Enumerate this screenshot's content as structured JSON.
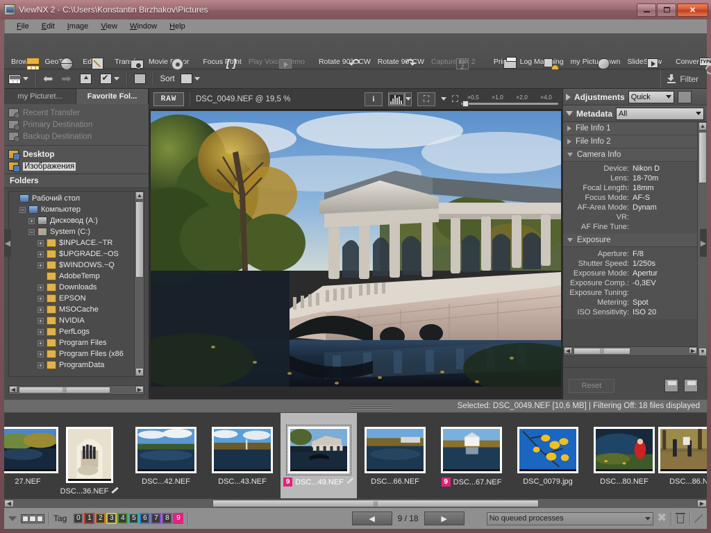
{
  "window": {
    "title": "ViewNX 2 - C:\\Users\\Konstantin Birzhakov\\Pictures",
    "app_icon": "viewnx-icon",
    "minimize_label": "–",
    "maximize_label": "❐",
    "close_label": "✕"
  },
  "menu": [
    {
      "label": "File"
    },
    {
      "label": "Edit"
    },
    {
      "label": "Image"
    },
    {
      "label": "View"
    },
    {
      "label": "Window"
    },
    {
      "label": "Help"
    }
  ],
  "toolbar": {
    "groups": [
      {
        "items": [
          {
            "label": "Browser",
            "icon": "browser-icon",
            "disabled": false
          },
          {
            "label": "GeoTag",
            "icon": "globe-icon",
            "disabled": false
          },
          {
            "label": "Edit",
            "icon": "pen-icon",
            "disabled": false
          }
        ]
      },
      {
        "items": [
          {
            "label": "Transfer",
            "icon": "camera-icon",
            "disabled": false
          },
          {
            "label": "Movie Editor",
            "icon": "film-reel-icon",
            "disabled": false
          }
        ]
      },
      {
        "items": [
          {
            "label": "Focus Point",
            "icon": "focus-brackets-icon",
            "disabled": false
          },
          {
            "label": "Play Voice Memo",
            "icon": "play-icon",
            "disabled": true
          }
        ]
      },
      {
        "items": [
          {
            "label": "Rotate 90°CCW",
            "icon": "rotate-ccw-icon",
            "disabled": false
          },
          {
            "label": "Rotate 90°CW",
            "icon": "rotate-cw-icon",
            "disabled": false
          },
          {
            "label": "Capture NX 2",
            "icon": "capture-nx-icon",
            "disabled": true
          }
        ]
      },
      {
        "items": [
          {
            "label": "Print",
            "icon": "printer-icon",
            "disabled": false
          },
          {
            "label": "Log Matching",
            "icon": "log-matching-icon",
            "disabled": false
          },
          {
            "label": "my Picturetown",
            "icon": "picturetown-icon",
            "disabled": false
          },
          {
            "label": "SlideShow",
            "icon": "slideshow-icon",
            "disabled": false
          }
        ]
      },
      {
        "items": [
          {
            "label": "Convert Files",
            "icon": "convert-files-icon",
            "disabled": false
          }
        ]
      }
    ]
  },
  "subbar": {
    "view_grid": "thumbnail-grid-icon",
    "back": "back-arrow-icon",
    "forward": "forward-arrow-icon",
    "up": "up-folder-icon",
    "rating": "check-mark-icon",
    "window": "window-icon",
    "sort_label": "Sort",
    "sort_icon": "camera-icon",
    "filter_label": "Filter",
    "filter_icon": "filter-download-icon"
  },
  "left_panel": {
    "tabs": [
      {
        "label": "my Picturet...",
        "active": false
      },
      {
        "label": "Favorite Fol...",
        "active": true
      }
    ],
    "transfer_items": [
      {
        "label": "Recent Transfer",
        "enabled": false
      },
      {
        "label": "Primary Destination",
        "enabled": false
      },
      {
        "label": "Backup Destination",
        "enabled": false
      }
    ],
    "favorites": [
      {
        "label": "Desktop",
        "selected": false
      },
      {
        "label": "Изображения",
        "selected": true
      }
    ],
    "folders_header": "Folders",
    "tree": [
      {
        "label": "Рабочий стол",
        "indent": 0,
        "expander": "",
        "icon": "desktop-icon"
      },
      {
        "label": "Компьютер",
        "indent": 1,
        "expander": "−",
        "icon": "computer-icon"
      },
      {
        "label": "Дисковод (A:)",
        "indent": 2,
        "expander": "+",
        "icon": "drive-icon"
      },
      {
        "label": "System (C:)",
        "indent": 2,
        "expander": "−",
        "icon": "system-drive-icon"
      },
      {
        "label": "$INPLACE.~TR",
        "indent": 3,
        "expander": "+",
        "icon": "folder-icon"
      },
      {
        "label": "$UPGRADE.~OS",
        "indent": 3,
        "expander": "+",
        "icon": "folder-icon"
      },
      {
        "label": "$WINDOWS.~Q",
        "indent": 3,
        "expander": "+",
        "icon": "folder-icon"
      },
      {
        "label": "AdobeTemp",
        "indent": 3,
        "expander": "",
        "icon": "folder-icon"
      },
      {
        "label": "Downloads",
        "indent": 3,
        "expander": "+",
        "icon": "folder-icon"
      },
      {
        "label": "EPSON",
        "indent": 3,
        "expander": "+",
        "icon": "folder-icon"
      },
      {
        "label": "MSOCache",
        "indent": 3,
        "expander": "+",
        "icon": "folder-icon"
      },
      {
        "label": "NVIDIA",
        "indent": 3,
        "expander": "+",
        "icon": "folder-icon"
      },
      {
        "label": "PerfLogs",
        "indent": 3,
        "expander": "+",
        "icon": "folder-icon"
      },
      {
        "label": "Program Files",
        "indent": 3,
        "expander": "+",
        "icon": "folder-icon"
      },
      {
        "label": "Program Files (x86",
        "indent": 3,
        "expander": "+",
        "icon": "folder-icon"
      },
      {
        "label": "ProgramData",
        "indent": 3,
        "expander": "+",
        "icon": "folder-icon"
      }
    ]
  },
  "viewer": {
    "raw_badge": "RAW",
    "file_title": "DSC_0049.NEF @ 19,5 %",
    "info_icon": "info-icon",
    "histogram_icon": "histogram-icon",
    "fit_icon": "fit-to-window-icon",
    "zoom_reset_icon": "zoom-reset-icon",
    "zoom_ticks": [
      "×0,5",
      "×1,0",
      "×2,0",
      "×4,0"
    ],
    "image_alt": "Marble Bridge in autumn park reflected in pond"
  },
  "right_panel": {
    "adjustments": {
      "title": "Adjustments",
      "mode": "Quick",
      "revert_icon": "revert-icon"
    },
    "metadata": {
      "title": "Metadata",
      "filter": "All"
    },
    "sections": [
      {
        "title": "File Info 1",
        "expanded": false,
        "rows": []
      },
      {
        "title": "File Info 2",
        "expanded": false,
        "rows": []
      },
      {
        "title": "Camera Info",
        "expanded": true,
        "rows": [
          {
            "label": "Device:",
            "value": "Nikon D"
          },
          {
            "label": "Lens:",
            "value": "18-70m"
          },
          {
            "label": "Focal Length:",
            "value": "18mm"
          },
          {
            "label": "Focus Mode:",
            "value": "AF-S"
          },
          {
            "label": "AF-Area Mode:",
            "value": "Dynam"
          },
          {
            "label": "VR:",
            "value": ""
          },
          {
            "label": "AF Fine Tune:",
            "value": ""
          }
        ]
      },
      {
        "title": "Exposure",
        "expanded": true,
        "rows": [
          {
            "label": "Aperture:",
            "value": "F/8"
          },
          {
            "label": "Shutter Speed:",
            "value": "1/250s"
          },
          {
            "label": "Exposure Mode:",
            "value": "Apertur"
          },
          {
            "label": "Exposure Comp.:",
            "value": "-0,3EV"
          },
          {
            "label": "Exposure Tuning:",
            "value": ""
          },
          {
            "label": "Metering:",
            "value": "Spot"
          },
          {
            "label": "ISO Sensitivity:",
            "value": "ISO 20"
          }
        ]
      }
    ],
    "reset_label": "Reset",
    "save_icons": [
      "save-as-icon",
      "save-icon"
    ]
  },
  "status": {
    "text": "Selected: DSC_0049.NEF [10,6 MB] | Filtering Off: 18 files displayed"
  },
  "filmstrip": [
    {
      "label": "27.NEF",
      "tag": "",
      "brush": false,
      "selected": false,
      "scene": "pond-autumn"
    },
    {
      "label": "DSC...36.NEF",
      "tag": "",
      "brush": true,
      "selected": false,
      "scene": "arch-people"
    },
    {
      "label": "DSC...42.NEF",
      "tag": "",
      "brush": false,
      "selected": false,
      "scene": "lake-clouds"
    },
    {
      "label": "DSC...43.NEF",
      "tag": "",
      "brush": false,
      "selected": false,
      "scene": "lake-shore"
    },
    {
      "label": "DSC...49.NEF",
      "tag": "9",
      "brush": true,
      "selected": true,
      "scene": "bridge"
    },
    {
      "label": "DSC...66.NEF",
      "tag": "",
      "brush": false,
      "selected": false,
      "scene": "park-lake"
    },
    {
      "label": "DSC...67.NEF",
      "tag": "9",
      "brush": false,
      "selected": false,
      "scene": "white-pavilion"
    },
    {
      "label": "DSC_0079.jpg",
      "tag": "",
      "brush": false,
      "selected": false,
      "scene": "yellow-leaves"
    },
    {
      "label": "DSC...80.NEF",
      "tag": "",
      "brush": false,
      "selected": false,
      "scene": "red-coat"
    },
    {
      "label": "DSC...86.N",
      "tag": "",
      "brush": false,
      "selected": false,
      "scene": "people-park"
    }
  ],
  "bottom_bar": {
    "expand_icon": "chevron-down-icon",
    "viewmode_icon": "filmstrip-view-icon",
    "tag_label": "Tag",
    "tags": [
      {
        "label": "0",
        "color": "#808080",
        "active": false
      },
      {
        "label": "1",
        "color": "#c0392b",
        "active": false
      },
      {
        "label": "2",
        "color": "#c87828",
        "active": false
      },
      {
        "label": "3",
        "color": "#d4c52a",
        "active": false
      },
      {
        "label": "4",
        "color": "#4a9e3a",
        "active": false
      },
      {
        "label": "5",
        "color": "#2ab5a5",
        "active": false
      },
      {
        "label": "6",
        "color": "#3a7bd5",
        "active": false
      },
      {
        "label": "7",
        "color": "#7a4fd0",
        "active": false
      },
      {
        "label": "8",
        "color": "#8e4fa0",
        "active": false
      },
      {
        "label": "9",
        "color": "#e0247e",
        "active": true
      }
    ],
    "prev_label": "◀",
    "next_label": "▶",
    "page_indicator": "9 / 18",
    "queue_text": "No queued processes",
    "cancel_icon": "cancel-icon",
    "delete_icon": "trash-icon"
  },
  "colors": {
    "accent_tag_active": "#e0247e",
    "titlebar": "#9c6b73",
    "close_button": "#d4512b",
    "panel_bg": "#4b4b4b",
    "toolbar_bg": "#4d4d4d"
  }
}
